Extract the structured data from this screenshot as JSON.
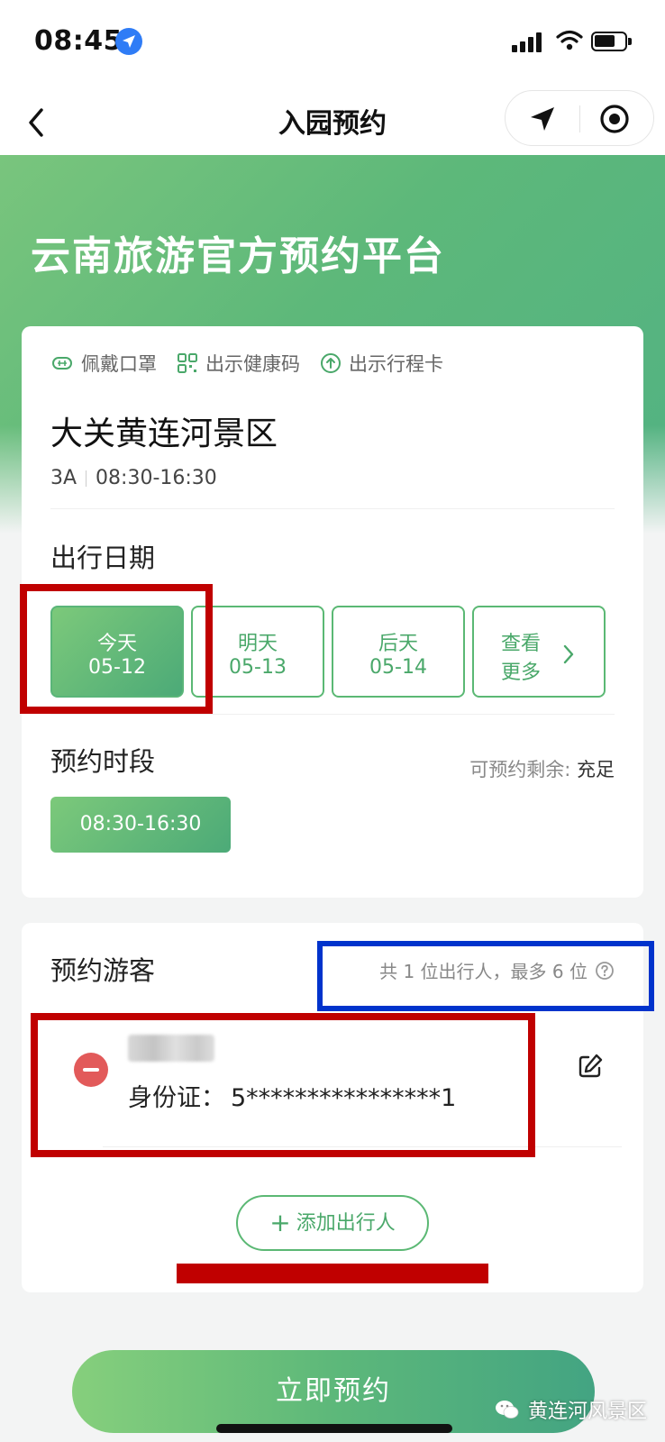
{
  "status_bar": {
    "time": "08:45"
  },
  "nav": {
    "title": "入园预约"
  },
  "hero": {
    "title": "云南旅游官方预约平台"
  },
  "tips": [
    {
      "icon": "mask-icon",
      "label": "佩戴口罩"
    },
    {
      "icon": "qr-code-icon",
      "label": "出示健康码"
    },
    {
      "icon": "itinerary-icon",
      "label": "出示行程卡"
    }
  ],
  "scenic": {
    "name": "大关黄连河景区",
    "level": "3A",
    "hours": "08:30-16:30"
  },
  "travel_date": {
    "title": "出行日期",
    "options": [
      {
        "line1": "今天",
        "line2": "05-12",
        "selected": true
      },
      {
        "line1": "明天",
        "line2": "05-13",
        "selected": false
      },
      {
        "line1": "后天",
        "line2": "05-14",
        "selected": false
      }
    ],
    "more": {
      "line1": "查看",
      "line2": "更多"
    }
  },
  "time_slot": {
    "title": "预约时段",
    "remain_label": "可预约剩余:",
    "remain_value": "充足",
    "slot": "08:30-16:30"
  },
  "guests": {
    "title": "预约游客",
    "count_text": "共 1 位出行人，最多 6 位",
    "items": [
      {
        "id_label": "身份证：",
        "id_value": "5****************1"
      }
    ],
    "add_label": "添加出行人"
  },
  "reserve_button": "立即预约",
  "watermark": "黄连河风景区",
  "colors": {
    "brand_green": "#5db87a",
    "danger_red": "#e25a5a",
    "annotation_red": "#c00000",
    "annotation_blue": "#0033cc"
  }
}
